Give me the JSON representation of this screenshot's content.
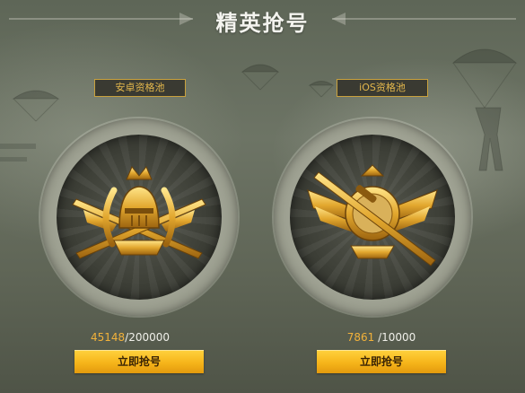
{
  "header": {
    "title": "精英抢号"
  },
  "pools": [
    {
      "label": "安卓资格池",
      "current": "45148",
      "total": "/200000",
      "button_label": "立即抢号",
      "badge_icon": "helmet-crossed-rifles-badge-icon"
    },
    {
      "label": "iOS资格池",
      "current": "7861",
      "total": " /10000",
      "button_label": "立即抢号",
      "badge_icon": "sniper-rifle-pan-badge-icon"
    }
  ],
  "colors": {
    "accent_gold": "#e3b74c",
    "count_highlight": "#f2b23a",
    "button_yellow": "#f6b51a",
    "background": "#6d7465"
  }
}
